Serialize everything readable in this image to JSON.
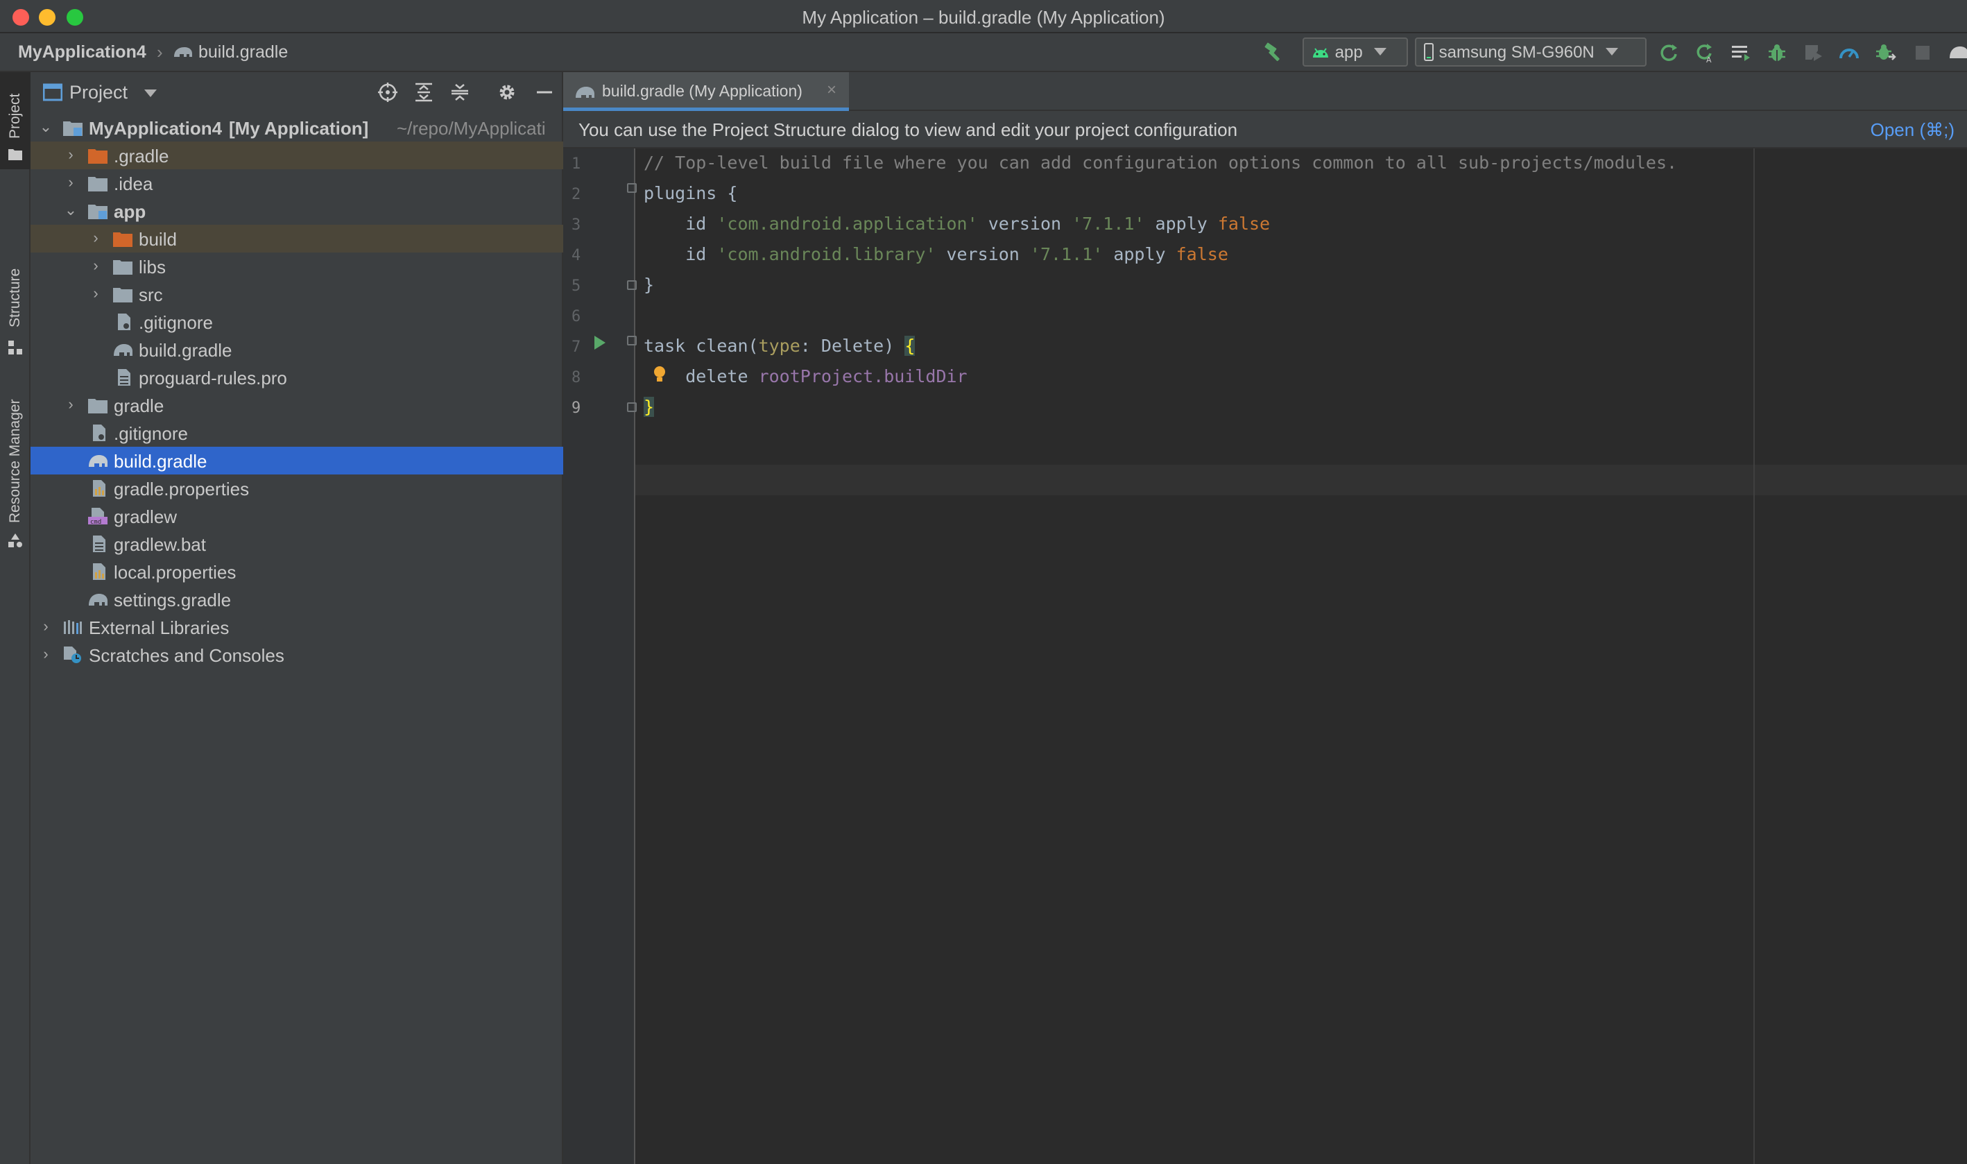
{
  "window": {
    "title": "My Application – build.gradle (My Application)"
  },
  "breadcrumb": {
    "project": "MyApplication4",
    "file": "build.gradle"
  },
  "toolbar": {
    "run_config": "app",
    "device": "samsung SM-G960N"
  },
  "side_stripe": {
    "tabs": [
      "Project",
      "Structure",
      "Resource Manager"
    ]
  },
  "project_panel": {
    "title": "Project",
    "root_name": "MyApplication4",
    "root_module": "[My Application]",
    "root_path": "~/repo/MyApplicati",
    "items": [
      {
        "label": ".gradle"
      },
      {
        "label": ".idea"
      },
      {
        "label": "app"
      },
      {
        "label": "build"
      },
      {
        "label": "libs"
      },
      {
        "label": "src"
      },
      {
        "label": ".gitignore"
      },
      {
        "label": "build.gradle"
      },
      {
        "label": "proguard-rules.pro"
      },
      {
        "label": "gradle"
      },
      {
        "label": ".gitignore"
      },
      {
        "label": "build.gradle"
      },
      {
        "label": "gradle.properties"
      },
      {
        "label": "gradlew"
      },
      {
        "label": "gradlew.bat"
      },
      {
        "label": "local.properties"
      },
      {
        "label": "settings.gradle"
      },
      {
        "label": "External Libraries"
      },
      {
        "label": "Scratches and Consoles"
      }
    ]
  },
  "editor": {
    "tab_label": "build.gradle (My Application)",
    "banner_text": "You can use the Project Structure dialog to view and edit your project configuration",
    "banner_link": "Open (⌘;)",
    "line_numbers": [
      "1",
      "2",
      "3",
      "4",
      "5",
      "6",
      "7",
      "8",
      "9"
    ],
    "code": {
      "l1": "// Top-level build file where you can add configuration options common to all sub-projects/modules.",
      "l2_kw": "plugins",
      "l2_rest": " {",
      "l3_a": "    id ",
      "l3_str": "'com.android.application'",
      "l3_b": " version ",
      "l3_ver": "'7.1.1'",
      "l3_c": " apply ",
      "l3_false": "false",
      "l4_a": "    id ",
      "l4_str": "'com.android.library'",
      "l4_b": " version ",
      "l4_ver": "'7.1.1'",
      "l4_c": " apply ",
      "l4_false": "false",
      "l5": "}",
      "l7_a": "task clean(",
      "l7_named": "type",
      "l7_b": ": Delete) ",
      "l7_brace": "{",
      "l8_a": "    delete ",
      "l8_prop": "rootProject.buildDir",
      "l9": "}"
    }
  },
  "colors": {
    "selection": "#2f65ca",
    "accent_link": "#589df6",
    "string": "#6a8759",
    "keyword": "#cc7832",
    "property": "#9876aa"
  }
}
